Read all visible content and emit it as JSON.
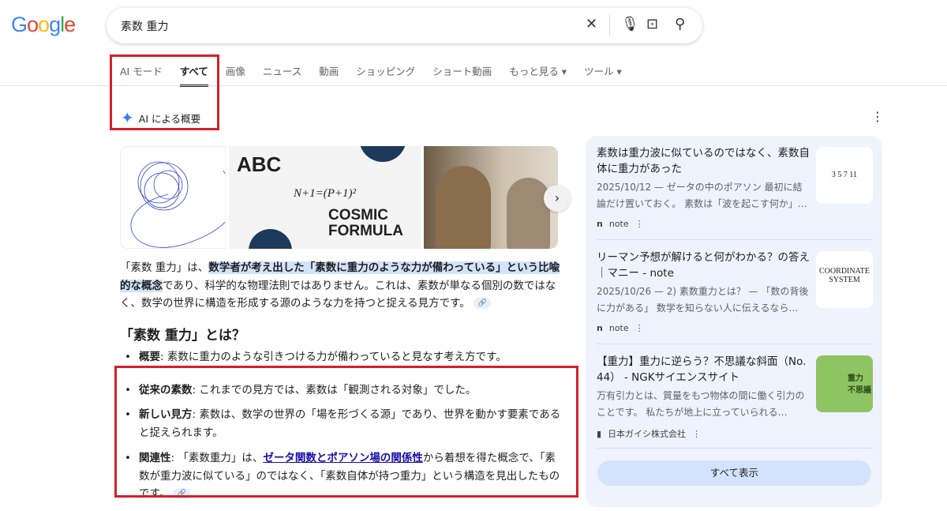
{
  "header": {
    "logo": "Google",
    "query": "素数 重力"
  },
  "tabs": [
    "AI モード",
    "すべて",
    "画像",
    "ニュース",
    "動画",
    "ショッピング",
    "ショート動画",
    "もっと見る ▾",
    "ツール ▾"
  ],
  "ai_overview": {
    "label": "AI による概要",
    "intro_pre": "「素数 重力」は、",
    "intro_hl": "数学者が考え出した「素数に重力のような力が備わっている」という比喩的な概念",
    "intro_post": "であり、科学的な物理法則ではありません。これは、素数が単なる個別の数ではなく、数学の世界に構造を形成する源のような力を持つと捉える見方です。",
    "image_texts": {
      "abc": "ABC",
      "formula": "N+1=(P+1)²",
      "cosmic": "COSMIC FORMULA"
    },
    "heading": "「素数 重力」とは？",
    "bullets": [
      {
        "term": "概要",
        "text": ": 素数に重力のような引きつける力が備わっていると見なす考え方です。"
      },
      {
        "term": "従来の素数",
        "text": ": これまでの見方では、素数は「観測される対象」でした。"
      },
      {
        "term": "新しい見方",
        "text": ": 素数は、数学の世界の「場を形づくる源」であり、世界を動かす要素であると捉えられます。"
      },
      {
        "term": "関連性",
        "pre": ": 「素数重力」は、",
        "link": "ゼータ関数とポアソン場の関係性",
        "text": "から着想を得た概念で、「素数が重力波に似ている」のではなく、「素数自体が持つ重力」という構造を見出したものです。"
      }
    ]
  },
  "sources": [
    {
      "title": "素数は重力波に似ているのではなく、素数自体に重力があった",
      "snippet": "2025/10/12 — ゼータの中のポアソン 最初に結論だけ置いておく。 素数は「波を起こす何か」…",
      "site": "note",
      "thumb": "3 5 7 11"
    },
    {
      "title": "リーマン予想が解けると何がわかる？の答え｜マニー - note",
      "snippet": "2025/10/26 — 2) 素数重力とは？ — 「数の背後に力がある」 数学を知らない人に伝えるなら…",
      "site": "note",
      "thumb": "COORDINATE SYSTEM"
    },
    {
      "title": "【重力】重力に逆らう？不思議な斜面（No. 44） - NGKサイエンスサイト",
      "snippet": "万有引力とは、質量をもつ物体の間に働く引力のことです。 私たちが地上に立っていられる…",
      "site": "日本ガイシ株式会社",
      "thumb": "重力 不思議"
    }
  ],
  "show_all": "すべて表示"
}
